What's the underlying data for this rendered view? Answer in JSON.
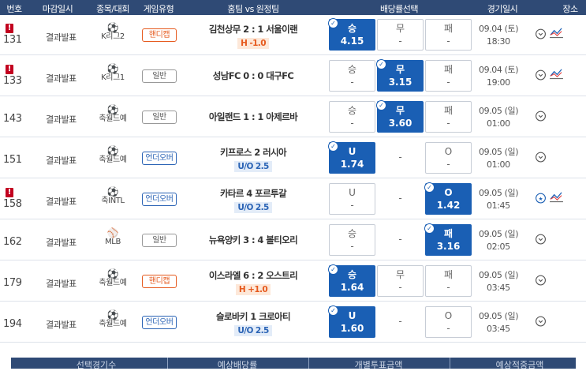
{
  "header": {
    "columns": [
      "번호",
      "마감일시",
      "종목/대회",
      "게임유형",
      "홈팀 vs 원정팀",
      "배당률선택",
      "경기일시",
      "장소"
    ]
  },
  "rows": [
    {
      "no": "131",
      "warn": true,
      "status": "결과발표",
      "league": "K리그2",
      "type": "핸디캡",
      "type_kind": "hc",
      "match": "김천상무 2 : 1 서울이랜",
      "sub": "H -1.0",
      "sub_kind": "hc",
      "opts": [
        {
          "l": "승",
          "v": "4.15",
          "sel": true,
          "plain": false
        },
        {
          "l": "무",
          "v": "-",
          "sel": false,
          "plain": false
        },
        {
          "l": "패",
          "v": "-",
          "sel": false,
          "plain": false
        }
      ],
      "date": "09.04 (토)",
      "time": "18:30",
      "trend": true,
      "pin_style": "normal"
    },
    {
      "no": "133",
      "warn": true,
      "status": "결과발표",
      "league": "K리그1",
      "type": "일반",
      "type_kind": "gen",
      "match": "성남FC 0 : 0 대구FC",
      "sub": "",
      "sub_kind": "",
      "opts": [
        {
          "l": "승",
          "v": "-",
          "sel": false,
          "plain": false
        },
        {
          "l": "무",
          "v": "3.15",
          "sel": true,
          "plain": false
        },
        {
          "l": "패",
          "v": "-",
          "sel": false,
          "plain": false
        }
      ],
      "date": "09.04 (토)",
      "time": "19:00",
      "trend": true,
      "pin_style": "normal"
    },
    {
      "no": "143",
      "warn": false,
      "status": "결과발표",
      "league": "축월드예",
      "type": "일반",
      "type_kind": "gen",
      "match": "아일랜드 1 : 1 아제르바",
      "sub": "",
      "sub_kind": "",
      "opts": [
        {
          "l": "승",
          "v": "-",
          "sel": false,
          "plain": false
        },
        {
          "l": "무",
          "v": "3.60",
          "sel": true,
          "plain": false
        },
        {
          "l": "패",
          "v": "-",
          "sel": false,
          "plain": false
        }
      ],
      "date": "09.05 (일)",
      "time": "01:00",
      "trend": false,
      "pin_style": "normal"
    },
    {
      "no": "151",
      "warn": false,
      "status": "결과발표",
      "league": "축월드예",
      "type": "언더오버",
      "type_kind": "uo",
      "match": "키프로스  2  러시아",
      "sub": "U/O 2.5",
      "sub_kind": "uo",
      "opts": [
        {
          "l": "U",
          "v": "1.74",
          "sel": true,
          "plain": false
        },
        {
          "l": "-",
          "v": "",
          "sel": false,
          "plain": true
        },
        {
          "l": "O",
          "v": "-",
          "sel": false,
          "plain": false
        }
      ],
      "date": "09.05 (일)",
      "time": "01:00",
      "trend": false,
      "pin_style": "normal"
    },
    {
      "no": "158",
      "warn": true,
      "status": "결과발표",
      "league": "축INTL",
      "type": "언더오버",
      "type_kind": "uo",
      "match": "카타르  4  포르투갈",
      "sub": "U/O 2.5",
      "sub_kind": "uo",
      "opts": [
        {
          "l": "U",
          "v": "-",
          "sel": false,
          "plain": false
        },
        {
          "l": "-",
          "v": "",
          "sel": false,
          "plain": true
        },
        {
          "l": "O",
          "v": "1.42",
          "sel": true,
          "plain": false
        }
      ],
      "date": "09.05 (일)",
      "time": "01:45",
      "trend": true,
      "pin_style": "star"
    },
    {
      "no": "162",
      "warn": false,
      "status": "결과발표",
      "league": "MLB",
      "type": "일반",
      "type_kind": "gen",
      "match": "뉴욕양키 3 : 4 볼티오리",
      "sub": "",
      "sub_kind": "",
      "opts": [
        {
          "l": "승",
          "v": "-",
          "sel": false,
          "plain": false
        },
        {
          "l": "-",
          "v": "",
          "sel": false,
          "plain": true
        },
        {
          "l": "패",
          "v": "3.16",
          "sel": true,
          "plain": false
        }
      ],
      "date": "09.05 (일)",
      "time": "02:05",
      "trend": false,
      "pin_style": "normal"
    },
    {
      "no": "179",
      "warn": false,
      "status": "결과발표",
      "league": "축월드예",
      "type": "핸디캡",
      "type_kind": "hc",
      "match": "이스라엘 6 : 2 오스트리",
      "sub": "H +1.0",
      "sub_kind": "hc",
      "opts": [
        {
          "l": "승",
          "v": "1.64",
          "sel": true,
          "plain": false
        },
        {
          "l": "무",
          "v": "-",
          "sel": false,
          "plain": false
        },
        {
          "l": "패",
          "v": "-",
          "sel": false,
          "plain": false
        }
      ],
      "date": "09.05 (일)",
      "time": "03:45",
      "trend": false,
      "pin_style": "normal"
    },
    {
      "no": "194",
      "warn": false,
      "status": "결과발표",
      "league": "축월드예",
      "type": "언더오버",
      "type_kind": "uo",
      "match": "슬로바키  1  크로아티",
      "sub": "U/O 2.5",
      "sub_kind": "uo",
      "opts": [
        {
          "l": "U",
          "v": "1.60",
          "sel": true,
          "plain": false
        },
        {
          "l": "-",
          "v": "",
          "sel": false,
          "plain": true
        },
        {
          "l": "O",
          "v": "-",
          "sel": false,
          "plain": false
        }
      ],
      "date": "09.05 (일)",
      "time": "03:45",
      "trend": false,
      "pin_style": "normal"
    }
  ],
  "footer": {
    "columns": [
      "선택경기수",
      "예상배당률",
      "개별투표금액",
      "예상적중금액"
    ]
  }
}
